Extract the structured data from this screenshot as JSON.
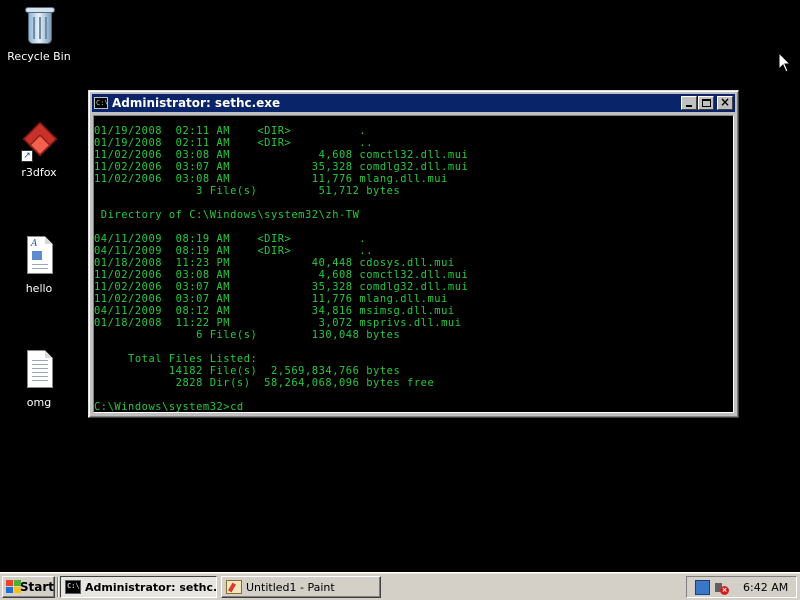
{
  "desktop": {
    "icons": [
      {
        "label": "Recycle Bin",
        "icon": "recycle-bin-icon"
      },
      {
        "label": "r3dfox",
        "icon": "r3dfox-app-icon"
      },
      {
        "label": "hello",
        "icon": "wordpad-document-icon"
      },
      {
        "label": "omg",
        "icon": "text-document-icon"
      }
    ]
  },
  "console": {
    "title": "Administrator: sethc.exe",
    "icon_text": "C:\\",
    "lines": [
      "01/19/2008  02:11 AM    <DIR>          .",
      "01/19/2008  02:11 AM    <DIR>          ..",
      "11/02/2006  03:08 AM             4,608 comctl32.dll.mui",
      "11/02/2006  03:07 AM            35,328 comdlg32.dll.mui",
      "11/02/2006  03:08 AM            11,776 mlang.dll.mui",
      "               3 File(s)         51,712 bytes",
      "",
      " Directory of C:\\Windows\\system32\\zh-TW",
      "",
      "04/11/2009  08:19 AM    <DIR>          .",
      "04/11/2009  08:19 AM    <DIR>          ..",
      "01/18/2008  11:23 PM            40,448 cdosys.dll.mui",
      "11/02/2006  03:08 AM             4,608 comctl32.dll.mui",
      "11/02/2006  03:07 AM            35,328 comdlg32.dll.mui",
      "11/02/2006  03:07 AM            11,776 mlang.dll.mui",
      "04/11/2009  08:12 AM            34,816 msimsg.dll.mui",
      "01/18/2008  11:22 PM             3,072 msprivs.dll.mui",
      "               6 File(s)        130,048 bytes",
      "",
      "     Total Files Listed:",
      "           14182 File(s)  2,569,834,766 bytes",
      "            2828 Dir(s)  58,264,068,096 bytes free",
      "",
      "C:\\Windows\\system32>cd"
    ]
  },
  "taskbar": {
    "start_label": "Start",
    "tasks": [
      {
        "label": "Administrator: sethc....",
        "icon": "cmd-icon",
        "active": true
      },
      {
        "label": "Untitled1 - Paint",
        "icon": "paint-icon",
        "active": false
      }
    ],
    "tray": {
      "icons": [
        "network-icon",
        "volume-muted-icon"
      ],
      "clock": "6:42 AM"
    }
  },
  "colors": {
    "console_text": "#27c93f",
    "console_bg": "#000000",
    "titlebar": "#0a246a",
    "desktop_bg": "#000000",
    "taskbar": "#d4d0c8"
  }
}
